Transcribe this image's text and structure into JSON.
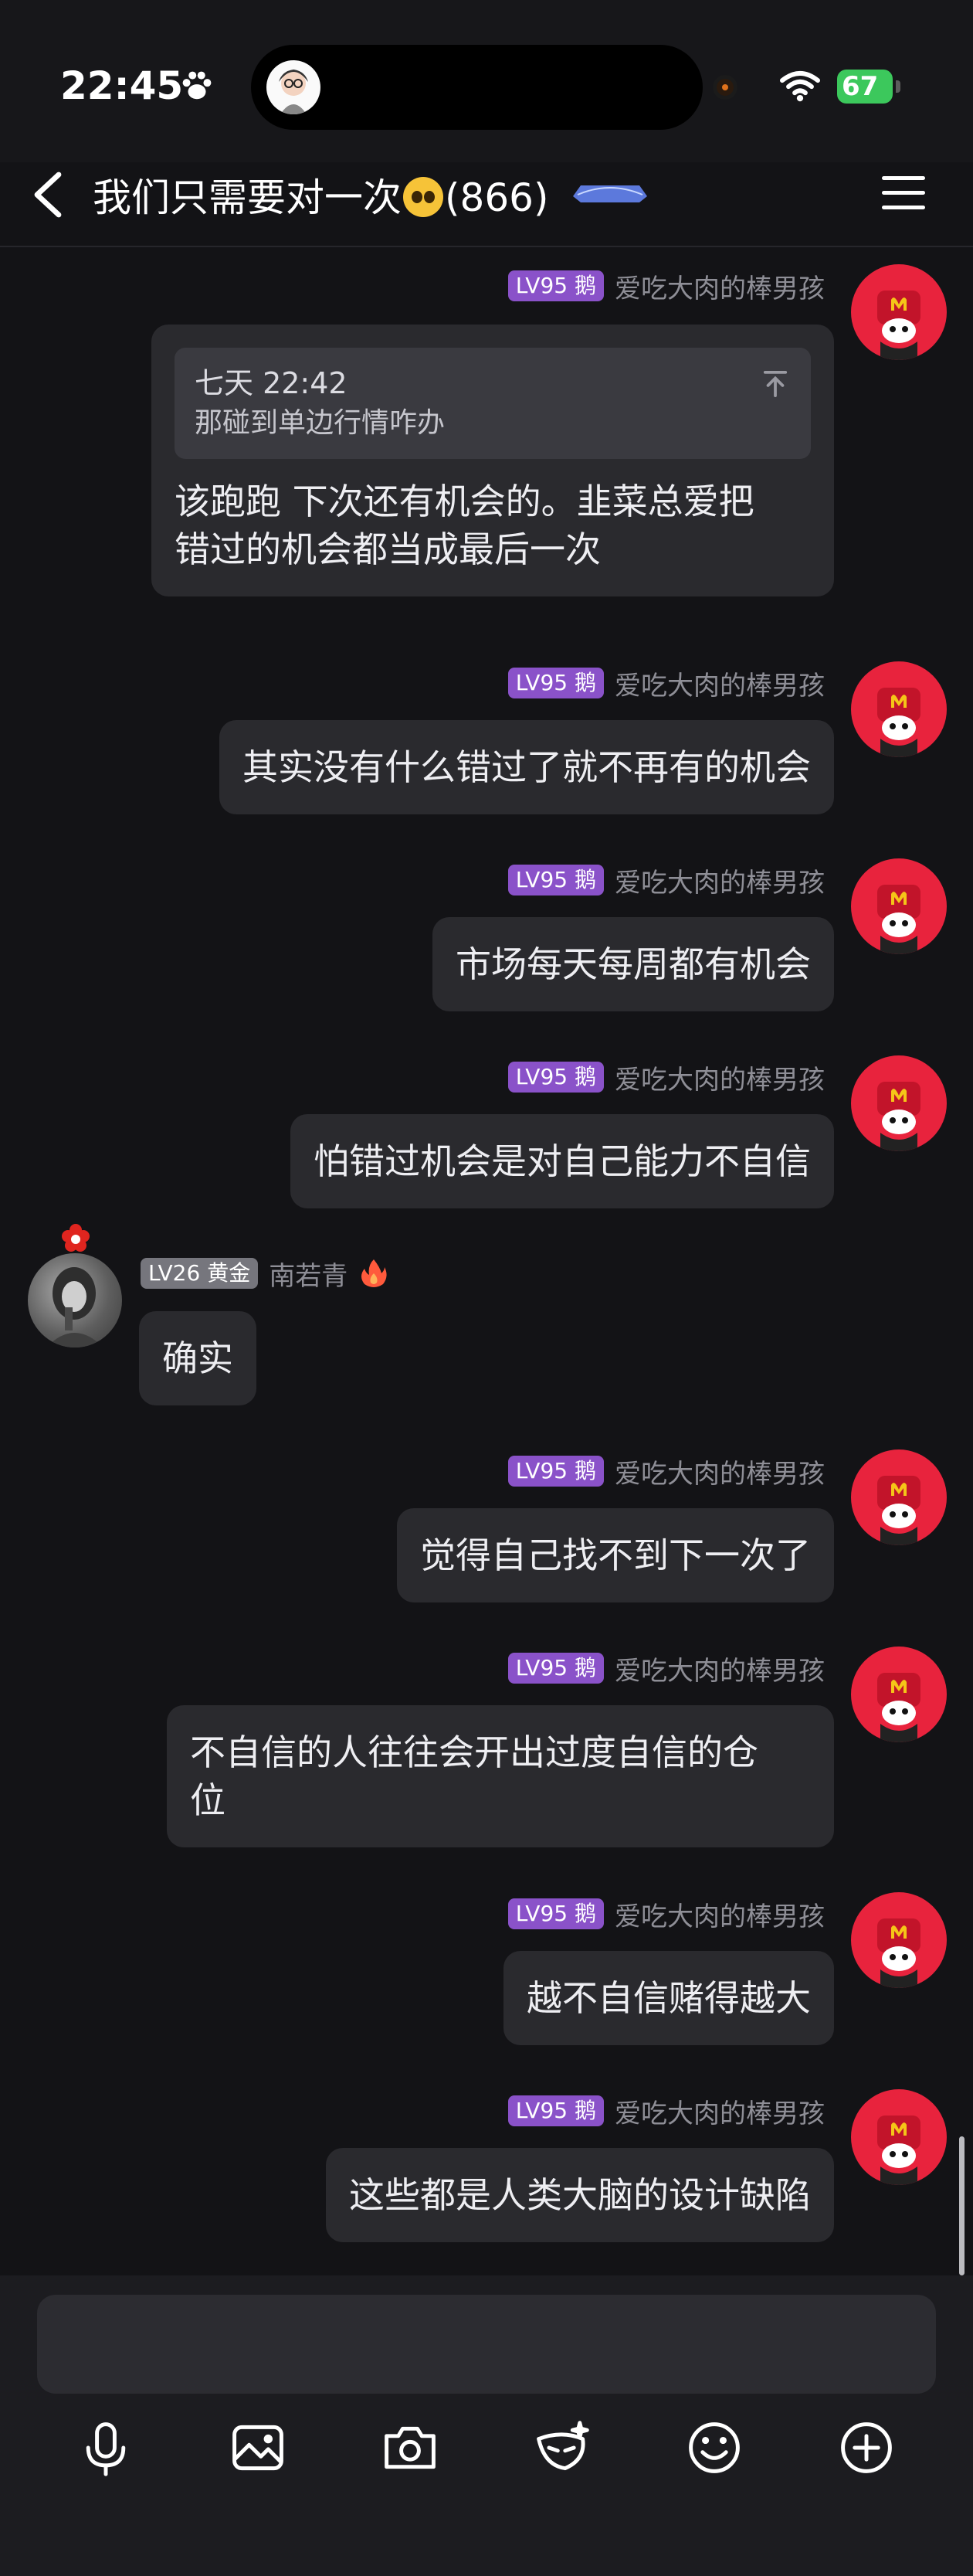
{
  "status_bar": {
    "time": "22:45",
    "battery": "67"
  },
  "header": {
    "title": "我们只需要对一次",
    "member_count": "(866)"
  },
  "messages": [
    {
      "side": "right",
      "level": "LV95 鹅",
      "name": "爱吃大肉的棒男孩",
      "quote_header": "七天 22:42",
      "quote_text": "那碰到单边行情咋办",
      "text_line1": "该跑跑 下次还有机会的。韭菜总爱把",
      "text_line2": "错过的机会都当成最后一次"
    },
    {
      "side": "right",
      "level": "LV95 鹅",
      "name": "爱吃大肉的棒男孩",
      "text": "其实没有什么错过了就不再有的机会"
    },
    {
      "side": "right",
      "level": "LV95 鹅",
      "name": "爱吃大肉的棒男孩",
      "text": "市场每天每周都有机会"
    },
    {
      "side": "right",
      "level": "LV95 鹅",
      "name": "爱吃大肉的棒男孩",
      "text": "怕错过机会是对自己能力不自信"
    },
    {
      "side": "left",
      "level": "LV26 黄金",
      "name": "南若青",
      "text": "确实"
    },
    {
      "side": "right",
      "level": "LV95 鹅",
      "name": "爱吃大肉的棒男孩",
      "text": "觉得自己找不到下一次了"
    },
    {
      "side": "right",
      "level": "LV95 鹅",
      "name": "爱吃大肉的棒男孩",
      "text_line1": "不自信的人往往会开出过度自信的仓",
      "text_line2": "位"
    },
    {
      "side": "right",
      "level": "LV95 鹅",
      "name": "爱吃大肉的棒男孩",
      "text": "越不自信赌得越大"
    },
    {
      "side": "right",
      "level": "LV95 鹅",
      "name": "爱吃大肉的棒男孩",
      "text": "这些都是人类大脑的设计缺陷"
    }
  ],
  "toolbar": [
    "mic-icon",
    "image-icon",
    "camera-icon",
    "mask-icon",
    "smile-icon",
    "plus-icon"
  ],
  "colors": {
    "background": "#131316",
    "bubble": "#2a2a2e",
    "level_badge": "#8a52c9",
    "avatar": "#e8233d"
  }
}
